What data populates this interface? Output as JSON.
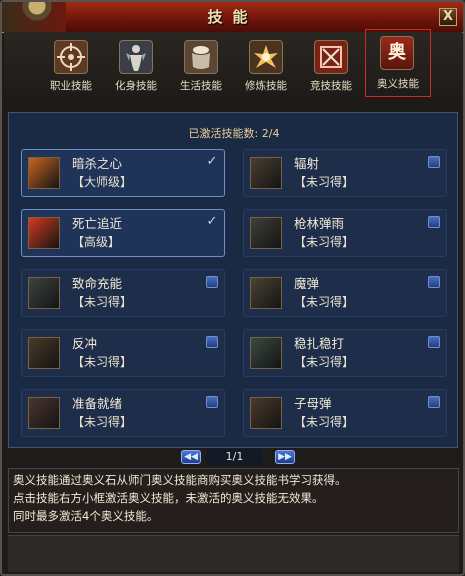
{
  "window": {
    "title": "技能",
    "close_glyph": "X"
  },
  "tabs": [
    {
      "label": "职业技能",
      "icon": "crosshair-icon",
      "active": false
    },
    {
      "label": "化身技能",
      "icon": "avatar-figure-icon",
      "active": false
    },
    {
      "label": "生活技能",
      "icon": "pot-icon",
      "active": false
    },
    {
      "label": "修炼技能",
      "icon": "burst-icon",
      "active": false
    },
    {
      "label": "竞技技能",
      "icon": "crossed-swords-icon",
      "active": false
    },
    {
      "label": "奥义技能",
      "icon": "ao-glyph-icon",
      "glyph": "奥",
      "active": true
    }
  ],
  "activated": {
    "label": "已激活技能数:",
    "value": "2/4"
  },
  "skills": [
    {
      "name": "暗杀之心",
      "grade": "【大师级】",
      "checked": true,
      "icon_color": "#c8641e"
    },
    {
      "name": "辐射",
      "grade": "【未习得】",
      "checked": false,
      "icon_color": "#4a3e30"
    },
    {
      "name": "死亡追近",
      "grade": "【高级】",
      "checked": true,
      "icon_color": "#d23a20"
    },
    {
      "name": "枪林弹雨",
      "grade": "【未习得】",
      "checked": false,
      "icon_color": "#3e4038"
    },
    {
      "name": "致命充能",
      "grade": "【未习得】",
      "checked": false,
      "icon_color": "#3a4640"
    },
    {
      "name": "魔弹",
      "grade": "【未习得】",
      "checked": false,
      "icon_color": "#4a4236"
    },
    {
      "name": "反冲",
      "grade": "【未习得】",
      "checked": false,
      "icon_color": "#4a3a28"
    },
    {
      "name": "稳扎稳打",
      "grade": "【未习得】",
      "checked": false,
      "icon_color": "#3a4a40"
    },
    {
      "name": "准备就绪",
      "grade": "【未习得】",
      "checked": false,
      "icon_color": "#4a3430"
    },
    {
      "name": "子母弹",
      "grade": "【未习得】",
      "checked": false,
      "icon_color": "#4a3a2a"
    }
  ],
  "pager": {
    "prev": "◀◀",
    "next": "▶▶",
    "page": "1/1"
  },
  "description": [
    "奥义技能通过奥义石从师门奥义技能商购买奥义技能书学习获得。",
    "点击技能右方小框激活奥义技能，未激活的奥义技能无效果。",
    "同时最多激活4个奥义技能。"
  ],
  "colors": {
    "accent_red": "#d32a1c",
    "panel_blue": "#1b2a44",
    "gold_text": "#e9cf96"
  }
}
